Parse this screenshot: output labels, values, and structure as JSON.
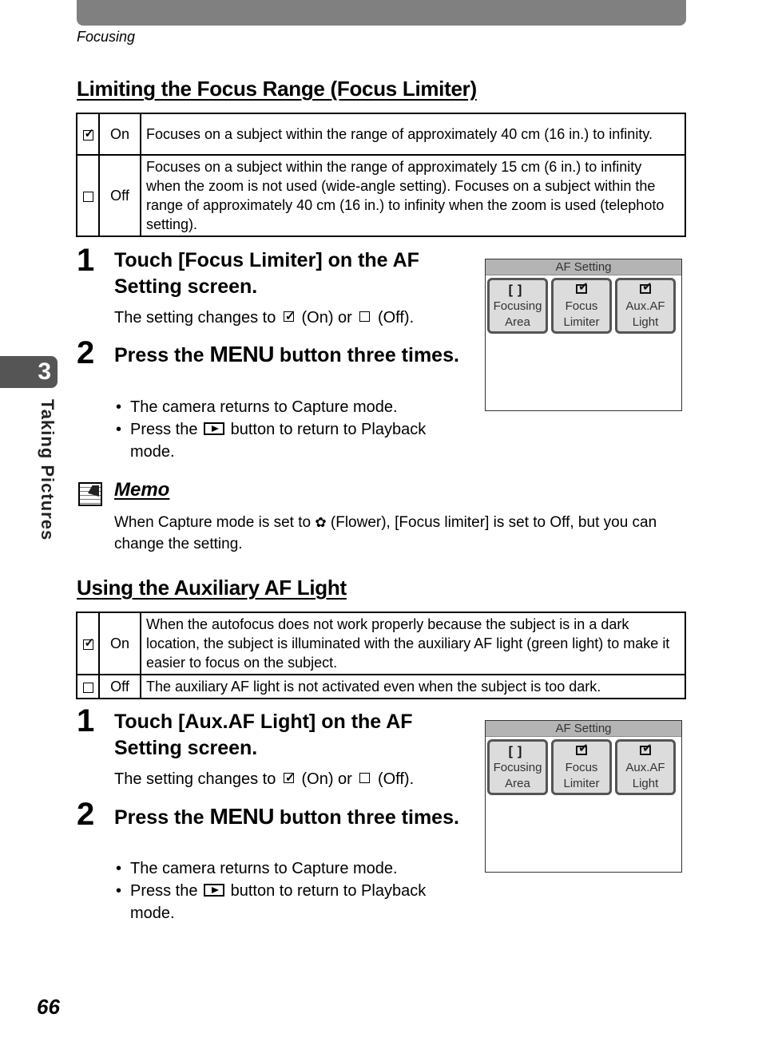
{
  "header": {
    "running_head": "Focusing"
  },
  "chapter": {
    "number": "3",
    "label": "Taking Pictures"
  },
  "section1": {
    "title": "Limiting the Focus Range (Focus Limiter)",
    "table": [
      {
        "icon": "checkbox-checked",
        "label": "On",
        "description": "Focuses on a subject within the range of approximately 40 cm (16 in.) to infinity."
      },
      {
        "icon": "checkbox-empty",
        "label": "Off",
        "description": "Focuses on a subject within the range of approximately 15 cm (6 in.) to infinity when the zoom is not used (wide-angle setting). Focuses on a subject within the range of approximately 40 cm (16 in.) to infinity when the zoom is used (telephoto setting)."
      }
    ],
    "steps": [
      {
        "num": "1",
        "title": "Touch [Focus Limiter] on the AF Setting screen.",
        "body_pre": "The setting changes to",
        "body_on": "(On) or",
        "body_off": "(Off)."
      },
      {
        "num": "2",
        "title_pre": "Press the",
        "title_menu": "MENU",
        "title_post": "button three times.",
        "bullets": [
          "The camera returns to Capture mode."
        ],
        "bullet2_pre": "Press the",
        "bullet2_post": "button to return to Playback mode."
      }
    ]
  },
  "memo": {
    "title": "Memo",
    "text_pre": "When Capture mode is set to",
    "text_post": "(Flower), [Focus limiter] is set to Off, but you can change the setting."
  },
  "section2": {
    "title": "Using the Auxiliary AF Light",
    "table": [
      {
        "icon": "checkbox-checked",
        "label": "On",
        "description": "When the autofocus does not work properly because the subject is in a dark location, the subject is illuminated with the auxiliary AF light (green light) to make it easier to focus on the subject."
      },
      {
        "icon": "checkbox-empty",
        "label": "Off",
        "description": "The auxiliary AF light is not activated even when the subject is too dark."
      }
    ],
    "steps": [
      {
        "num": "1",
        "title": "Touch [Aux.AF Light] on the AF Setting screen.",
        "body_pre": "The setting changes to",
        "body_on": "(On) or",
        "body_off": "(Off)."
      },
      {
        "num": "2",
        "title_pre": "Press the",
        "title_menu": "MENU",
        "title_post": "button three times.",
        "bullets": [
          "The camera returns to Capture mode."
        ],
        "bullet2_pre": "Press the",
        "bullet2_post": "button to return to Playback mode."
      }
    ]
  },
  "af_screen": {
    "title": "AF Setting",
    "buttons": [
      {
        "line1": "Focusing",
        "line2": "Area",
        "icon": "focus-bracket"
      },
      {
        "line1": "Focus",
        "line2": "Limiter",
        "icon": "checkbox-checked"
      },
      {
        "line1": "Aux.AF",
        "line2": "Light",
        "icon": "checkbox-checked"
      }
    ]
  },
  "footer": {
    "page_number": "66"
  }
}
